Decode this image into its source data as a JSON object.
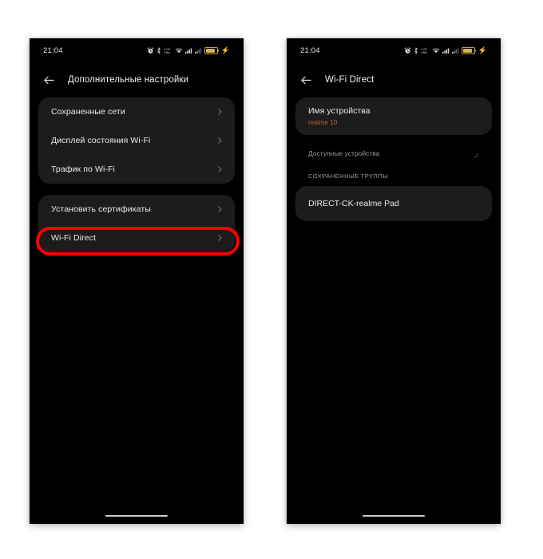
{
  "page": {
    "background": "#ffffff",
    "accent_orange": "#c9602a",
    "annotation_color": "#ff0000",
    "card_background": "#1c1c1c",
    "screen_background": "#000000"
  },
  "phones": [
    {
      "id": "phone-left",
      "status_bar": {
        "time": "21:04",
        "icons": [
          "alarm-icon",
          "bluetooth-icon",
          "data-speed-icon",
          "wifi-icon",
          "signal-bars-icon",
          "signal-bars-2-icon",
          "battery-icon",
          "charging-bolt-icon"
        ]
      },
      "app_bar": {
        "back_icon": "back-arrow-icon",
        "title": "Дополнительные настройки"
      },
      "cards": [
        {
          "rows": [
            {
              "label": "Сохраненные сети",
              "chevron": "chevron-right-icon",
              "highlighted": false
            },
            {
              "label": "Дисплей состояния Wi-Fi",
              "chevron": "chevron-right-icon",
              "highlighted": false
            },
            {
              "label": "Трафик по Wi-Fi",
              "chevron": "chevron-right-icon",
              "highlighted": false
            }
          ]
        },
        {
          "rows": [
            {
              "label": "Установить сертификаты",
              "chevron": "chevron-right-icon",
              "highlighted": false
            },
            {
              "label": "Wi-Fi Direct",
              "chevron": "chevron-right-icon",
              "highlighted": true
            }
          ]
        }
      ]
    },
    {
      "id": "phone-right",
      "status_bar": {
        "time": "21:04",
        "icons": [
          "alarm-icon",
          "bluetooth-icon",
          "data-speed-icon",
          "wifi-icon",
          "signal-bars-icon",
          "signal-bars-2-icon",
          "battery-icon",
          "charging-bolt-icon"
        ]
      },
      "app_bar": {
        "back_icon": "back-arrow-icon",
        "title": "Wi-Fi Direct"
      },
      "device_name": {
        "title": "Имя устройства",
        "value": "realme 10"
      },
      "available_devices": {
        "label": "Доступные устройства",
        "spinner": "loading-spinner-icon"
      },
      "saved_groups": {
        "section_title": "СОХРАНЕННЫЕ ГРУППЫ",
        "items": [
          {
            "name": "DIRECT-CK-realme Pad"
          }
        ]
      }
    }
  ]
}
